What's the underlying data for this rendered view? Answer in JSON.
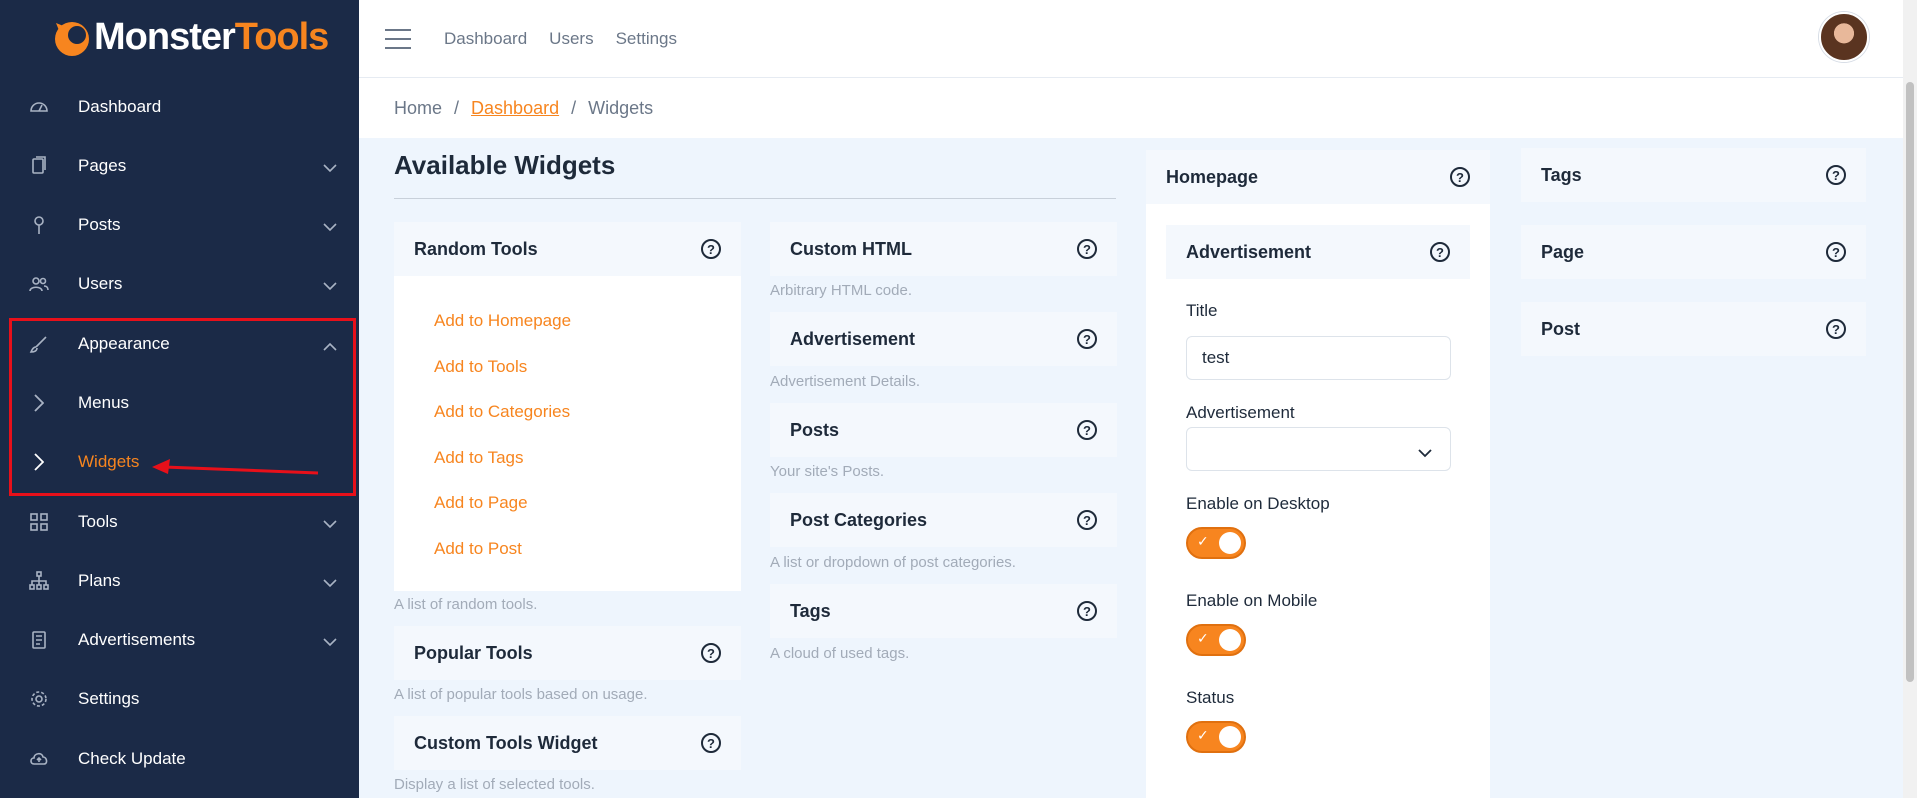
{
  "brand": {
    "part1": "Monster",
    "part2": "Tools"
  },
  "sidebar": {
    "items": [
      {
        "label": "Dashboard",
        "icon": "dashboard-gauge-icon"
      },
      {
        "label": "Pages",
        "icon": "pages-icon"
      },
      {
        "label": "Posts",
        "icon": "pin-icon"
      },
      {
        "label": "Users",
        "icon": "users-icon"
      },
      {
        "label": "Appearance",
        "icon": "brush-icon"
      },
      {
        "label": "Menus",
        "icon": "chevron-right-icon"
      },
      {
        "label": "Widgets",
        "icon": "chevron-right-icon"
      },
      {
        "label": "Tools",
        "icon": "grid-icon"
      },
      {
        "label": "Plans",
        "icon": "hierarchy-icon"
      },
      {
        "label": "Advertisements",
        "icon": "receipt-icon"
      },
      {
        "label": "Settings",
        "icon": "gear-icon"
      },
      {
        "label": "Check Update",
        "icon": "cloud-upload-icon"
      }
    ],
    "active": "Widgets"
  },
  "topbar": {
    "links": [
      "Dashboard",
      "Users",
      "Settings"
    ]
  },
  "breadcrumb": {
    "home": "Home",
    "current_parent": "Dashboard",
    "current": "Widgets",
    "separator": "/"
  },
  "available": {
    "title": "Available Widgets",
    "random_tools": {
      "title": "Random Tools",
      "actions": [
        "Add to Homepage",
        "Add to Tools",
        "Add to Categories",
        "Add to Tags",
        "Add to Page",
        "Add to Post"
      ],
      "desc": "A list of random tools."
    },
    "popular_tools": {
      "title": "Popular Tools",
      "desc": "A list of popular tools based on usage."
    },
    "custom_tools": {
      "title": "Custom Tools Widget",
      "desc": "Display a list of selected tools."
    },
    "custom_html": {
      "title": "Custom HTML",
      "desc": "Arbitrary HTML code."
    },
    "advertisement": {
      "title": "Advertisement",
      "desc": "Advertisement Details."
    },
    "posts": {
      "title": "Posts",
      "desc": "Your site's Posts."
    },
    "post_categories": {
      "title": "Post Categories",
      "desc": "A list or dropdown of post categories."
    },
    "tags": {
      "title": "Tags",
      "desc": "A cloud of used tags."
    }
  },
  "homepage": {
    "title": "Homepage",
    "widget_title": "Advertisement",
    "fields": {
      "title_label": "Title",
      "title_value": "test",
      "advertisement_label": "Advertisement",
      "advertisement_value": "",
      "desktop_label": "Enable on Desktop",
      "desktop_enabled": true,
      "mobile_label": "Enable on Mobile",
      "mobile_enabled": true,
      "status_label": "Status",
      "status_enabled": true
    }
  },
  "side_areas": {
    "tags": "Tags",
    "page": "Page",
    "post": "Post"
  },
  "help_glyph": "?",
  "check_glyph": "✓",
  "colors": {
    "sidebar_bg": "#1b2a47",
    "accent": "#f7851f",
    "highlight": "#e8101a",
    "content_bg": "#eef5fd"
  }
}
